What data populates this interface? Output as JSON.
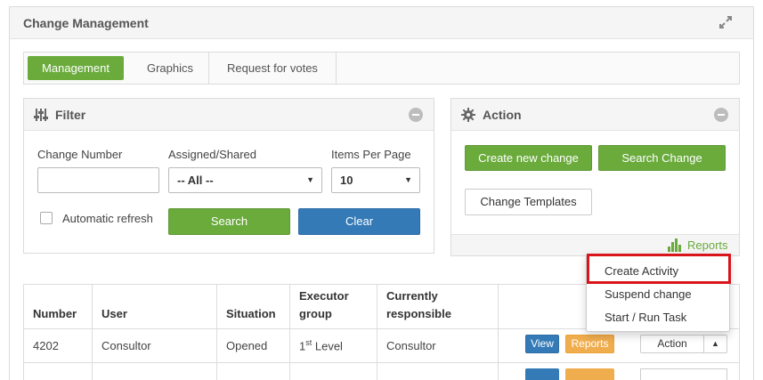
{
  "header": {
    "title": "Change Management"
  },
  "tabs": [
    {
      "label": "Management",
      "active": true
    },
    {
      "label": "Graphics",
      "active": false
    },
    {
      "label": "Request for votes",
      "active": false
    }
  ],
  "filter": {
    "title": "Filter",
    "change_number_label": "Change Number",
    "change_number_value": "",
    "assigned_label": "Assigned/Shared",
    "assigned_value": "-- All --",
    "items_per_page_label": "Items Per Page",
    "items_per_page_value": "10",
    "auto_refresh_label": "Automatic refresh",
    "search_label": "Search",
    "clear_label": "Clear"
  },
  "action": {
    "title": "Action",
    "create_label": "Create new change",
    "search_change_label": "Search Change",
    "templates_label": "Change Templates",
    "reports_label": "Reports"
  },
  "menu": {
    "items": [
      "Create Activity",
      "Suspend change",
      "Start / Run Task"
    ]
  },
  "table": {
    "headers": [
      "Number",
      "User",
      "Situation",
      "Executor group",
      "Currently responsible"
    ],
    "rows": [
      {
        "number": "4202",
        "user": "Consultor",
        "situation": "Opened",
        "group_num": "1",
        "group_sup": "st",
        "group_rest": " Level",
        "responsible": "Consultor",
        "view": "View",
        "reports": "Reports",
        "action": "Action"
      }
    ]
  },
  "colors": {
    "green": "#6aab3c",
    "blue": "#337ab7",
    "orange": "#f0ad4e",
    "highlight": "#d9151b"
  }
}
